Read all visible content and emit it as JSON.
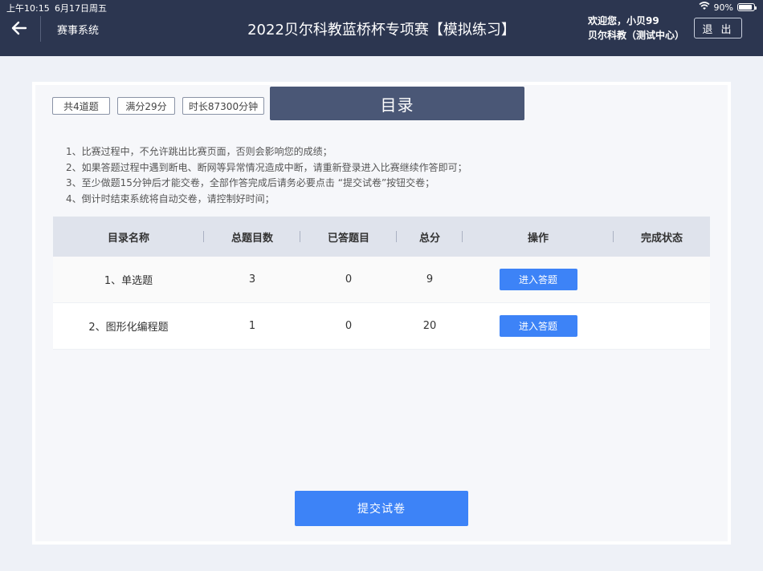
{
  "status_bar": {
    "time": "上午10:15",
    "date": "6月17日周五",
    "battery": "90%",
    "battery_level": 0.9
  },
  "header": {
    "system_name": "赛事系统",
    "title": "2022贝尔科教蓝桥杯专项赛【模拟练习】",
    "welcome": "欢迎您，小贝99",
    "org": "贝尔科教（测试中心）",
    "logout_label": "退 出"
  },
  "summary": {
    "question_count": "共4道题",
    "full_score": "满分29分",
    "duration": "时长87300分钟"
  },
  "catalog_tab": "目录",
  "rules": [
    "1、比赛过程中，不允许跳出比赛页面，否则会影响您的成绩；",
    "2、如果答题过程中遇到断电、断网等异常情况造成中断，请重新登录进入比赛继续作答即可；",
    "3、至少做题15分钟后才能交卷，全部作答完成后请务必要点击 “提交试卷”按钮交卷；",
    "4、倒计时结束系统将自动交卷，请控制好时间；"
  ],
  "table": {
    "headers": [
      "目录名称",
      "总题目数",
      "已答题目",
      "总分",
      "操作",
      "完成状态"
    ],
    "rows": [
      {
        "name": "1、单选题",
        "total": "3",
        "answered": "0",
        "score": "9",
        "action": "进入答题",
        "status": ""
      },
      {
        "name": "2、图形化编程题",
        "total": "1",
        "answered": "0",
        "score": "20",
        "action": "进入答题",
        "status": ""
      }
    ]
  },
  "submit_label": "提交试卷",
  "colors": {
    "header_bg": "#2c3650",
    "accent": "#3d83f7",
    "tab_bg": "#4a5776"
  }
}
